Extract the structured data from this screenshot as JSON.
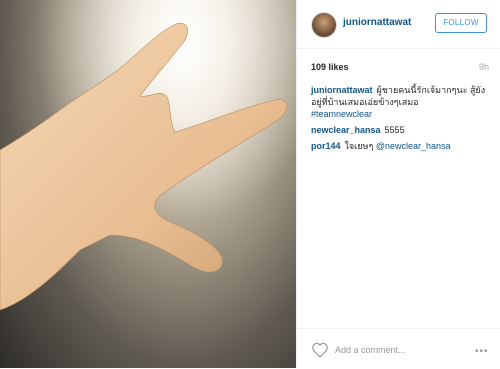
{
  "post": {
    "username": "juniornattawat",
    "follow_label": "FOLLOW",
    "likes": "109 likes",
    "time": "9h"
  },
  "comments": [
    {
      "user": "juniornattawat",
      "text": "ผู้ชายคนนี้รักเจ้มากๆนะ สู้ยังอยู่ที่บ้านเสมอเอ่ยข้างๆเสมอ",
      "tag": "#teamnewclear"
    },
    {
      "user": "newclear_hansa",
      "text": "5555"
    },
    {
      "user": "por144",
      "text": "ใจเยษๆ",
      "mention": "@newclear_hansa"
    }
  ],
  "footer": {
    "add_comment_placeholder": "Add a comment...",
    "more_icon": "ellipsis-icon"
  }
}
